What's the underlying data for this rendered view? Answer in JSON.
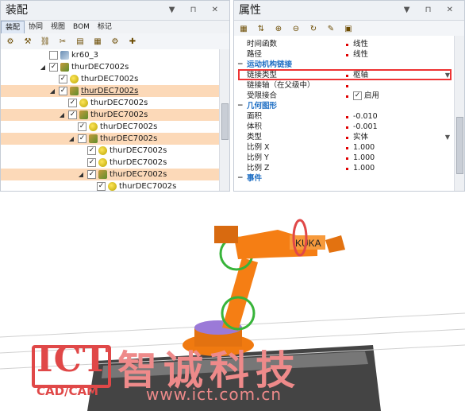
{
  "assembly": {
    "title": "装配",
    "tabs": [
      "装配",
      "协同",
      "视图",
      "BOM",
      "标记"
    ],
    "tree": [
      {
        "label": "kr60_3",
        "level": 0,
        "icon": "robot-icon",
        "highlight": false,
        "expanded": false
      },
      {
        "label": "thurDEC7002s",
        "level": 0,
        "icon": "assembly-icon",
        "highlight": false,
        "expanded": true
      },
      {
        "label": "thurDEC7002s",
        "level": 1,
        "icon": "part-icon",
        "highlight": false,
        "expanded": false
      },
      {
        "label": "thurDEC7002s",
        "level": 1,
        "icon": "assembly-icon",
        "highlight": true,
        "expanded": true,
        "underline": true
      },
      {
        "label": "thurDEC7002s",
        "level": 2,
        "icon": "part-icon",
        "highlight": false,
        "expanded": false
      },
      {
        "label": "thurDEC7002s",
        "level": 2,
        "icon": "assembly-icon",
        "highlight": true,
        "expanded": true
      },
      {
        "label": "thurDEC7002s",
        "level": 3,
        "icon": "part-icon",
        "highlight": false,
        "expanded": false
      },
      {
        "label": "thurDEC7002s",
        "level": 3,
        "icon": "assembly-icon",
        "highlight": true,
        "expanded": true
      },
      {
        "label": "thurDEC7002s",
        "level": 4,
        "icon": "part-icon",
        "highlight": false,
        "expanded": false
      },
      {
        "label": "thurDEC7002s",
        "level": 4,
        "icon": "part-icon",
        "highlight": false,
        "expanded": false
      },
      {
        "label": "thurDEC7002s",
        "level": 4,
        "icon": "assembly-icon",
        "highlight": true,
        "expanded": true
      },
      {
        "label": "thurDEC7002s",
        "level": 5,
        "icon": "part-icon",
        "highlight": false,
        "expanded": false
      }
    ]
  },
  "properties": {
    "title": "属性",
    "rows": [
      {
        "type": "prop",
        "key": "时间函数",
        "value": "线性"
      },
      {
        "type": "prop",
        "key": "路径",
        "value": "线性"
      },
      {
        "type": "category",
        "key": "运动机构链接"
      },
      {
        "type": "prop",
        "key": "链接类型",
        "value": "枢轴",
        "dropdown": true,
        "boxed": true
      },
      {
        "type": "prop",
        "key": "链接轴（在父级中）",
        "value": ""
      },
      {
        "type": "prop",
        "key": "受限接合",
        "value": "启用",
        "check": true
      },
      {
        "type": "category",
        "key": "几何图形"
      },
      {
        "type": "prop",
        "key": "面积",
        "value": "-0.010"
      },
      {
        "type": "prop",
        "key": "体积",
        "value": "-0.001"
      },
      {
        "type": "prop",
        "key": "类型",
        "value": "实体",
        "dropdown": true
      },
      {
        "type": "prop",
        "key": "比例 X",
        "value": "1.000"
      },
      {
        "type": "prop",
        "key": "比例 Y",
        "value": "1.000"
      },
      {
        "type": "prop",
        "key": "比例 Z",
        "value": "1.000"
      },
      {
        "type": "category",
        "key": "事件"
      }
    ]
  },
  "viewport": {
    "robot_label": "KUKA",
    "watermark": {
      "brand": "ICT",
      "sub": "CAD/CAM",
      "name": "智诚科技",
      "url": "www.ict.com.cn"
    }
  },
  "colors": {
    "highlight": "#fcd9b8",
    "category": "#1f6fc4",
    "robot": "#f07a10",
    "accent_red": "#e04848"
  }
}
